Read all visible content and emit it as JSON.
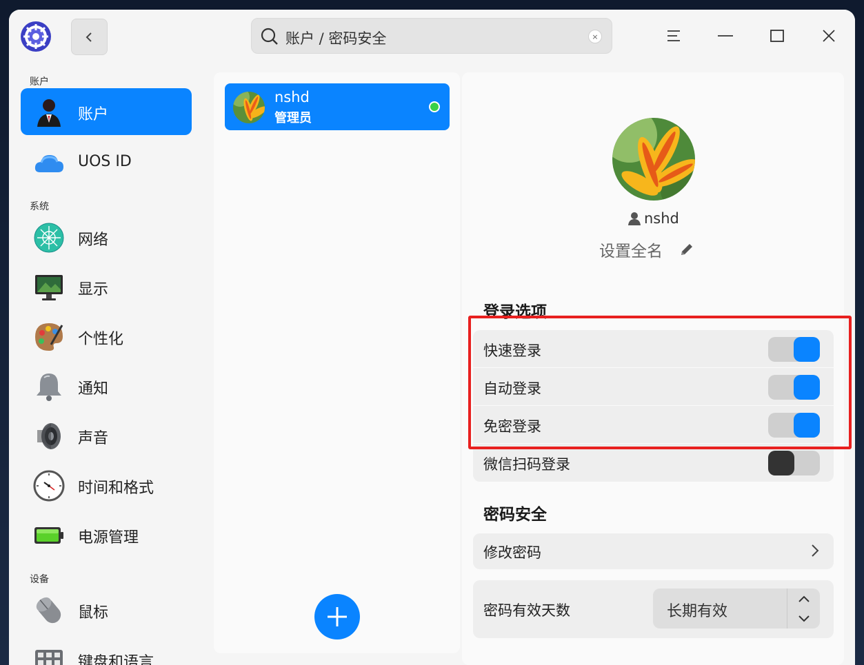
{
  "search": {
    "text": "账户 / 密码安全",
    "clear_symbol": "×"
  },
  "sidebar": {
    "sections": [
      {
        "label": "账户"
      },
      {
        "label": "系统"
      },
      {
        "label": "设备"
      }
    ],
    "items": [
      {
        "label": "账户",
        "icon": "account-icon",
        "active": true
      },
      {
        "label": "UOS ID",
        "icon": "cloud-icon"
      },
      {
        "label": "网络",
        "icon": "network-icon"
      },
      {
        "label": "显示",
        "icon": "display-icon"
      },
      {
        "label": "个性化",
        "icon": "palette-icon"
      },
      {
        "label": "通知",
        "icon": "bell-icon"
      },
      {
        "label": "声音",
        "icon": "speaker-icon"
      },
      {
        "label": "时间和格式",
        "icon": "clock-icon"
      },
      {
        "label": "电源管理",
        "icon": "battery-icon"
      },
      {
        "label": "鼠标",
        "icon": "mouse-icon"
      },
      {
        "label": "键盘和语言",
        "icon": "keyboard-icon"
      }
    ]
  },
  "users": [
    {
      "name": "nshd",
      "role": "管理员",
      "online": true
    }
  ],
  "detail": {
    "username": "nshd",
    "fullname_placeholder": "设置全名",
    "login_options": {
      "title": "登录选项",
      "items": [
        {
          "label": "快速登录",
          "enabled": true
        },
        {
          "label": "自动登录",
          "enabled": true
        },
        {
          "label": "免密登录",
          "enabled": true
        },
        {
          "label": "微信扫码登录",
          "enabled": false
        }
      ]
    },
    "password_security": {
      "title": "密码安全",
      "change_password": "修改密码",
      "validity_label": "密码有效天数",
      "validity_value": "长期有效"
    }
  },
  "colors": {
    "accent": "#0a84ff",
    "highlight": "#e8201f",
    "online": "#3ad148"
  }
}
